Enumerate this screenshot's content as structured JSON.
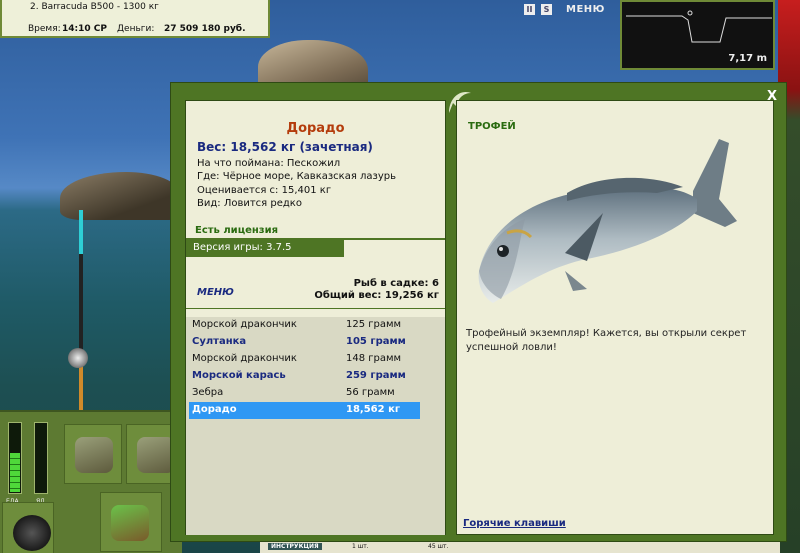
{
  "status": {
    "tackle": "2. Barracuda B500 - 1300 кг",
    "time_label": "Время:",
    "time": "14:10 СР",
    "money_label": "Деньги:",
    "money": "27 509 180 руб."
  },
  "toolbar": {
    "pause": "II",
    "sound": "S",
    "menu": "МЕНЮ"
  },
  "depth": {
    "value": "7,17 m"
  },
  "meters": {
    "food_label": "ЕДА",
    "fd_label": "ЯД",
    "food_level": 0.55
  },
  "bottom": {
    "button": "ИНСТРУКЦИЯ",
    "cell1": "1 шт.",
    "cell2": "45 шт."
  },
  "dialog": {
    "close": "X",
    "fish": {
      "name": "Дорадо",
      "weight": "Вес: 18,562 кг (зачетная)",
      "caught_on": "На что поймана: Пескожил",
      "where": "Где: Чёрное море, Кавказская лазурь",
      "price": "Оценивается с: 15,401 кг",
      "kind": "Вид: Ловится редко"
    },
    "license": "Есть лицензия",
    "version": "Версия игры: 3.7.5",
    "cage_menu": "МЕНЮ",
    "cage_count": "Рыб в садке: 6",
    "cage_total": "Общий вес: 19,256 кг",
    "cage": [
      {
        "name": "Морской дракончик",
        "weight": "125 грамм",
        "style": "normal"
      },
      {
        "name": "Султанка",
        "weight": "105 грамм",
        "style": "rare"
      },
      {
        "name": "Морской дракончик",
        "weight": "148 грамм",
        "style": "normal"
      },
      {
        "name": "Морской карась",
        "weight": "259 грамм",
        "style": "rare"
      },
      {
        "name": "Зебра",
        "weight": "56 грамм",
        "style": "normal"
      },
      {
        "name": "Дорадо",
        "weight": "18,562 кг",
        "style": "selected"
      }
    ],
    "trophy_label": "ТРОФЕЙ",
    "trophy_text": "Трофейный экземпляр! Кажется, вы открыли секрет успешной ловли!",
    "hotkeys": "Горячие клавиши"
  },
  "colors": {
    "panel_green": "#4e7524",
    "page_bg": "#eeeed8",
    "title_orange": "#b43c0c",
    "rare_blue": "#1a2a80",
    "selected": "#2f98f4"
  }
}
